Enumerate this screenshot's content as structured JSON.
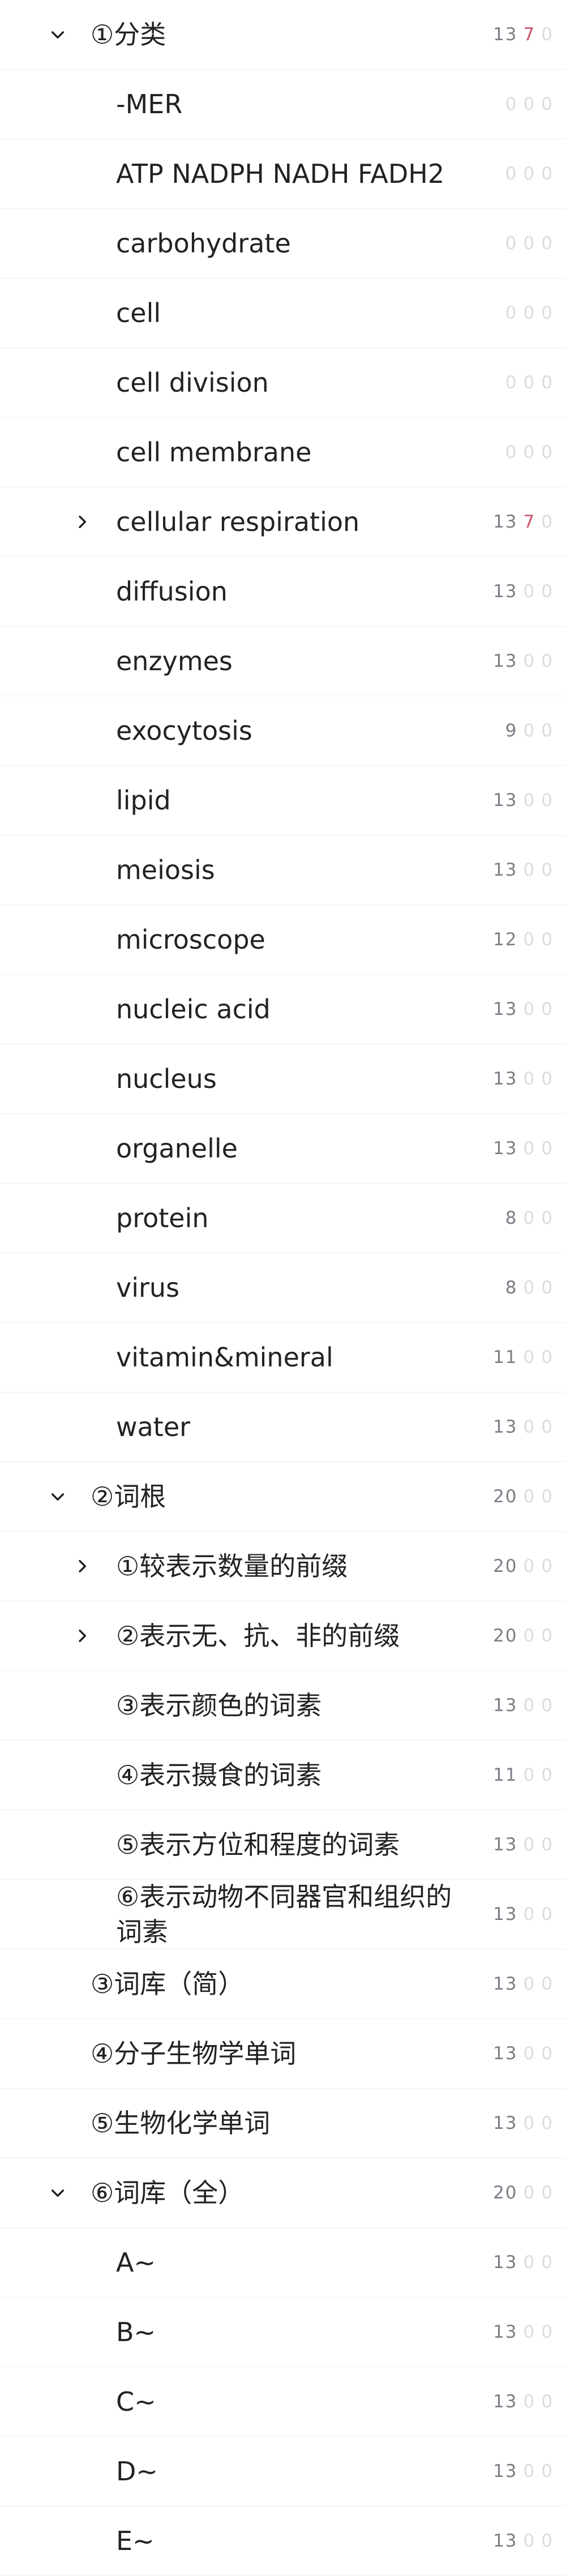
{
  "colors": {
    "count_total": "#7c7c86",
    "count_zero": "#dcdcdc",
    "count_red": "#c9546a",
    "divider": "#efefef"
  },
  "rows": [
    {
      "label": "①分类",
      "depth": 0,
      "toggle": "expanded",
      "total": "13",
      "a": "7",
      "b": "0"
    },
    {
      "label": "-MER",
      "depth": 2,
      "toggle": "none",
      "total": "0",
      "a": "0",
      "b": "0"
    },
    {
      "label": "ATP NADPH NADH FADH2",
      "depth": 2,
      "toggle": "none",
      "total": "0",
      "a": "0",
      "b": "0"
    },
    {
      "label": "carbohydrate",
      "depth": 2,
      "toggle": "none",
      "total": "0",
      "a": "0",
      "b": "0"
    },
    {
      "label": "cell",
      "depth": 2,
      "toggle": "none",
      "total": "0",
      "a": "0",
      "b": "0"
    },
    {
      "label": "cell division",
      "depth": 2,
      "toggle": "none",
      "total": "0",
      "a": "0",
      "b": "0"
    },
    {
      "label": "cell membrane",
      "depth": 2,
      "toggle": "none",
      "total": "0",
      "a": "0",
      "b": "0"
    },
    {
      "label": "cellular respiration",
      "depth": 2,
      "toggle": "collapsed",
      "total": "13",
      "a": "7",
      "b": "0"
    },
    {
      "label": "diffusion",
      "depth": 2,
      "toggle": "none",
      "total": "13",
      "a": "0",
      "b": "0"
    },
    {
      "label": "enzymes",
      "depth": 2,
      "toggle": "none",
      "total": "13",
      "a": "0",
      "b": "0"
    },
    {
      "label": "exocytosis",
      "depth": 2,
      "toggle": "none",
      "total": "9",
      "a": "0",
      "b": "0"
    },
    {
      "label": "lipid",
      "depth": 2,
      "toggle": "none",
      "total": "13",
      "a": "0",
      "b": "0"
    },
    {
      "label": "meiosis",
      "depth": 2,
      "toggle": "none",
      "total": "13",
      "a": "0",
      "b": "0"
    },
    {
      "label": "microscope",
      "depth": 2,
      "toggle": "none",
      "total": "12",
      "a": "0",
      "b": "0"
    },
    {
      "label": "nucleic acid",
      "depth": 2,
      "toggle": "none",
      "total": "13",
      "a": "0",
      "b": "0"
    },
    {
      "label": "nucleus",
      "depth": 2,
      "toggle": "none",
      "total": "13",
      "a": "0",
      "b": "0"
    },
    {
      "label": "organelle",
      "depth": 2,
      "toggle": "none",
      "total": "13",
      "a": "0",
      "b": "0"
    },
    {
      "label": "protein",
      "depth": 2,
      "toggle": "none",
      "total": "8",
      "a": "0",
      "b": "0"
    },
    {
      "label": "virus",
      "depth": 2,
      "toggle": "none",
      "total": "8",
      "a": "0",
      "b": "0"
    },
    {
      "label": "vitamin&mineral",
      "depth": 2,
      "toggle": "none",
      "total": "11",
      "a": "0",
      "b": "0"
    },
    {
      "label": "water",
      "depth": 2,
      "toggle": "none",
      "total": "13",
      "a": "0",
      "b": "0"
    },
    {
      "label": "②词根",
      "depth": 0,
      "toggle": "expanded",
      "total": "20",
      "a": "0",
      "b": "0"
    },
    {
      "label": "①较表示数量的前缀",
      "depth": 2,
      "toggle": "collapsed",
      "total": "20",
      "a": "0",
      "b": "0"
    },
    {
      "label": "②表示无、抗、非的前缀",
      "depth": 2,
      "toggle": "collapsed",
      "total": "20",
      "a": "0",
      "b": "0"
    },
    {
      "label": "③表示颜色的词素",
      "depth": 2,
      "toggle": "none",
      "total": "13",
      "a": "0",
      "b": "0"
    },
    {
      "label": "④表示摄食的词素",
      "depth": 2,
      "toggle": "none",
      "total": "11",
      "a": "0",
      "b": "0"
    },
    {
      "label": "⑤表示方位和程度的词素",
      "depth": 2,
      "toggle": "none",
      "total": "13",
      "a": "0",
      "b": "0"
    },
    {
      "label": "⑥表示动物不同器官和组织的词素",
      "depth": 2,
      "toggle": "none",
      "total": "13",
      "a": "0",
      "b": "0",
      "wrap": true
    },
    {
      "label": "③词库（简）",
      "depth": 1,
      "toggle": "none",
      "total": "13",
      "a": "0",
      "b": "0"
    },
    {
      "label": "④分子生物学单词",
      "depth": 1,
      "toggle": "none",
      "total": "13",
      "a": "0",
      "b": "0"
    },
    {
      "label": "⑤生物化学单词",
      "depth": 1,
      "toggle": "none",
      "total": "13",
      "a": "0",
      "b": "0"
    },
    {
      "label": "⑥词库（全）",
      "depth": 0,
      "toggle": "expanded",
      "total": "20",
      "a": "0",
      "b": "0"
    },
    {
      "label": "A~",
      "depth": 2,
      "toggle": "none",
      "total": "13",
      "a": "0",
      "b": "0"
    },
    {
      "label": "B~",
      "depth": 2,
      "toggle": "none",
      "total": "13",
      "a": "0",
      "b": "0"
    },
    {
      "label": "C~",
      "depth": 2,
      "toggle": "none",
      "total": "13",
      "a": "0",
      "b": "0"
    },
    {
      "label": "D~",
      "depth": 2,
      "toggle": "none",
      "total": "13",
      "a": "0",
      "b": "0"
    },
    {
      "label": "E~",
      "depth": 2,
      "toggle": "none",
      "total": "13",
      "a": "0",
      "b": "0"
    }
  ]
}
